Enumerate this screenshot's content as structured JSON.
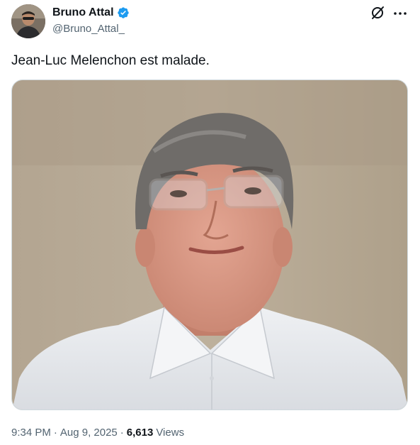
{
  "author": {
    "name": "Bruno Attal",
    "handle": "@Bruno_Attal_",
    "verified": true,
    "badge_color": "#1d9bf0"
  },
  "icons": {
    "verified": "verified-badge-icon",
    "grok": "grok-icon",
    "more": "more-options-icon"
  },
  "tweet": {
    "text": "Jean-Luc Melenchon est malade."
  },
  "meta": {
    "time": "9:34 PM",
    "date": "Aug 9, 2025",
    "separator": "·",
    "views_count": "6,613",
    "views_label": "Views"
  },
  "colors": {
    "text_primary": "#0f1419",
    "text_secondary": "#536471",
    "border": "#cfd9de"
  }
}
